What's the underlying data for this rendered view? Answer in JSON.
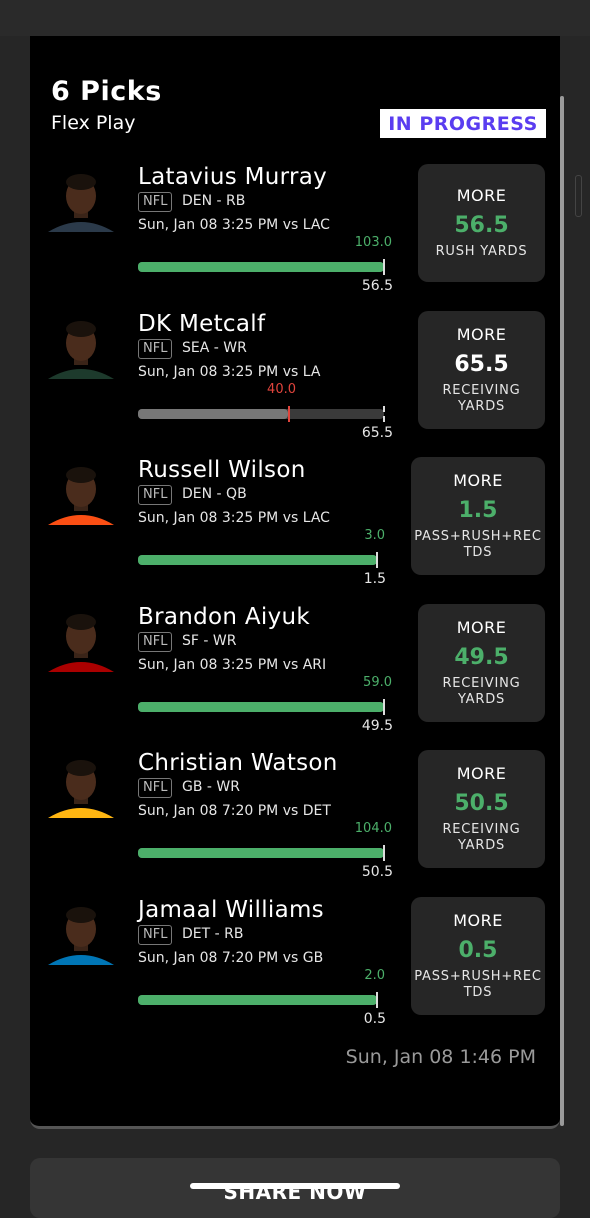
{
  "header": {
    "title": "6 Picks",
    "subtitle": "Flex Play",
    "status": "IN PROGRESS"
  },
  "colors": {
    "green": "#4caf6a",
    "red": "#e0443c",
    "status_text": "#5a3df0"
  },
  "picks": [
    {
      "name": "Latavius Murray",
      "league": "NFL",
      "team_pos": "DEN - RB",
      "game": "Sun, Jan 08 3:25 PM  vs LAC",
      "actual": "103.0",
      "line": "56.5",
      "progress": 1.0,
      "hit": true,
      "direction": "MORE",
      "line_box": "56.5",
      "stat": "RUSH YARDS",
      "jersey": "#2b3a4a"
    },
    {
      "name": "DK Metcalf",
      "league": "NFL",
      "team_pos": "SEA - WR",
      "game": "Sun, Jan 08 3:25 PM  vs LA",
      "actual": "40.0",
      "line": "65.5",
      "progress": 0.61,
      "hit": false,
      "direction": "MORE",
      "line_box": "65.5",
      "stat": "RECEIVING YARDS",
      "jersey": "#1d3a2c"
    },
    {
      "name": "Russell Wilson",
      "league": "NFL",
      "team_pos": "DEN - QB",
      "game": "Sun, Jan 08 3:25 PM  vs LAC",
      "actual": "3.0",
      "line": "1.5",
      "progress": 1.0,
      "hit": true,
      "direction": "MORE",
      "line_box": "1.5",
      "stat": "PASS+RUSH+REC TDS",
      "jersey": "#fb4f14"
    },
    {
      "name": "Brandon Aiyuk",
      "league": "NFL",
      "team_pos": "SF - WR",
      "game": "Sun, Jan 08 3:25 PM  vs ARI",
      "actual": "59.0",
      "line": "49.5",
      "progress": 1.0,
      "hit": true,
      "direction": "MORE",
      "line_box": "49.5",
      "stat": "RECEIVING YARDS",
      "jersey": "#aa0000"
    },
    {
      "name": "Christian Watson",
      "league": "NFL",
      "team_pos": "GB - WR",
      "game": "Sun, Jan 08 7:20 PM  vs DET",
      "actual": "104.0",
      "line": "50.5",
      "progress": 1.0,
      "hit": true,
      "direction": "MORE",
      "line_box": "50.5",
      "stat": "RECEIVING YARDS",
      "jersey": "#ffb612"
    },
    {
      "name": "Jamaal Williams",
      "league": "NFL",
      "team_pos": "DET - RB",
      "game": "Sun, Jan 08 7:20 PM  vs GB",
      "actual": "2.0",
      "line": "0.5",
      "progress": 1.0,
      "hit": true,
      "direction": "MORE",
      "line_box": "0.5",
      "stat": "PASS+RUSH+REC TDS",
      "jersey": "#0076b6"
    }
  ],
  "timestamp": "Sun, Jan 08 1:46 PM",
  "share_label": "SHARE NOW"
}
